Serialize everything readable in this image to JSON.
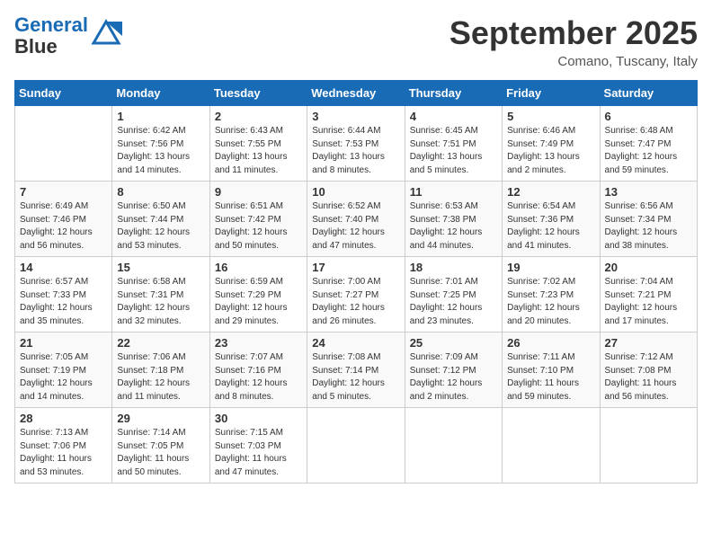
{
  "logo": {
    "line1": "General",
    "line2": "Blue"
  },
  "header": {
    "month": "September 2025",
    "location": "Comano, Tuscany, Italy"
  },
  "weekdays": [
    "Sunday",
    "Monday",
    "Tuesday",
    "Wednesday",
    "Thursday",
    "Friday",
    "Saturday"
  ],
  "weeks": [
    [
      {
        "day": "",
        "info": ""
      },
      {
        "day": "1",
        "info": "Sunrise: 6:42 AM\nSunset: 7:56 PM\nDaylight: 13 hours\nand 14 minutes."
      },
      {
        "day": "2",
        "info": "Sunrise: 6:43 AM\nSunset: 7:55 PM\nDaylight: 13 hours\nand 11 minutes."
      },
      {
        "day": "3",
        "info": "Sunrise: 6:44 AM\nSunset: 7:53 PM\nDaylight: 13 hours\nand 8 minutes."
      },
      {
        "day": "4",
        "info": "Sunrise: 6:45 AM\nSunset: 7:51 PM\nDaylight: 13 hours\nand 5 minutes."
      },
      {
        "day": "5",
        "info": "Sunrise: 6:46 AM\nSunset: 7:49 PM\nDaylight: 13 hours\nand 2 minutes."
      },
      {
        "day": "6",
        "info": "Sunrise: 6:48 AM\nSunset: 7:47 PM\nDaylight: 12 hours\nand 59 minutes."
      }
    ],
    [
      {
        "day": "7",
        "info": "Sunrise: 6:49 AM\nSunset: 7:46 PM\nDaylight: 12 hours\nand 56 minutes."
      },
      {
        "day": "8",
        "info": "Sunrise: 6:50 AM\nSunset: 7:44 PM\nDaylight: 12 hours\nand 53 minutes."
      },
      {
        "day": "9",
        "info": "Sunrise: 6:51 AM\nSunset: 7:42 PM\nDaylight: 12 hours\nand 50 minutes."
      },
      {
        "day": "10",
        "info": "Sunrise: 6:52 AM\nSunset: 7:40 PM\nDaylight: 12 hours\nand 47 minutes."
      },
      {
        "day": "11",
        "info": "Sunrise: 6:53 AM\nSunset: 7:38 PM\nDaylight: 12 hours\nand 44 minutes."
      },
      {
        "day": "12",
        "info": "Sunrise: 6:54 AM\nSunset: 7:36 PM\nDaylight: 12 hours\nand 41 minutes."
      },
      {
        "day": "13",
        "info": "Sunrise: 6:56 AM\nSunset: 7:34 PM\nDaylight: 12 hours\nand 38 minutes."
      }
    ],
    [
      {
        "day": "14",
        "info": "Sunrise: 6:57 AM\nSunset: 7:33 PM\nDaylight: 12 hours\nand 35 minutes."
      },
      {
        "day": "15",
        "info": "Sunrise: 6:58 AM\nSunset: 7:31 PM\nDaylight: 12 hours\nand 32 minutes."
      },
      {
        "day": "16",
        "info": "Sunrise: 6:59 AM\nSunset: 7:29 PM\nDaylight: 12 hours\nand 29 minutes."
      },
      {
        "day": "17",
        "info": "Sunrise: 7:00 AM\nSunset: 7:27 PM\nDaylight: 12 hours\nand 26 minutes."
      },
      {
        "day": "18",
        "info": "Sunrise: 7:01 AM\nSunset: 7:25 PM\nDaylight: 12 hours\nand 23 minutes."
      },
      {
        "day": "19",
        "info": "Sunrise: 7:02 AM\nSunset: 7:23 PM\nDaylight: 12 hours\nand 20 minutes."
      },
      {
        "day": "20",
        "info": "Sunrise: 7:04 AM\nSunset: 7:21 PM\nDaylight: 12 hours\nand 17 minutes."
      }
    ],
    [
      {
        "day": "21",
        "info": "Sunrise: 7:05 AM\nSunset: 7:19 PM\nDaylight: 12 hours\nand 14 minutes."
      },
      {
        "day": "22",
        "info": "Sunrise: 7:06 AM\nSunset: 7:18 PM\nDaylight: 12 hours\nand 11 minutes."
      },
      {
        "day": "23",
        "info": "Sunrise: 7:07 AM\nSunset: 7:16 PM\nDaylight: 12 hours\nand 8 minutes."
      },
      {
        "day": "24",
        "info": "Sunrise: 7:08 AM\nSunset: 7:14 PM\nDaylight: 12 hours\nand 5 minutes."
      },
      {
        "day": "25",
        "info": "Sunrise: 7:09 AM\nSunset: 7:12 PM\nDaylight: 12 hours\nand 2 minutes."
      },
      {
        "day": "26",
        "info": "Sunrise: 7:11 AM\nSunset: 7:10 PM\nDaylight: 11 hours\nand 59 minutes."
      },
      {
        "day": "27",
        "info": "Sunrise: 7:12 AM\nSunset: 7:08 PM\nDaylight: 11 hours\nand 56 minutes."
      }
    ],
    [
      {
        "day": "28",
        "info": "Sunrise: 7:13 AM\nSunset: 7:06 PM\nDaylight: 11 hours\nand 53 minutes."
      },
      {
        "day": "29",
        "info": "Sunrise: 7:14 AM\nSunset: 7:05 PM\nDaylight: 11 hours\nand 50 minutes."
      },
      {
        "day": "30",
        "info": "Sunrise: 7:15 AM\nSunset: 7:03 PM\nDaylight: 11 hours\nand 47 minutes."
      },
      {
        "day": "",
        "info": ""
      },
      {
        "day": "",
        "info": ""
      },
      {
        "day": "",
        "info": ""
      },
      {
        "day": "",
        "info": ""
      }
    ]
  ]
}
